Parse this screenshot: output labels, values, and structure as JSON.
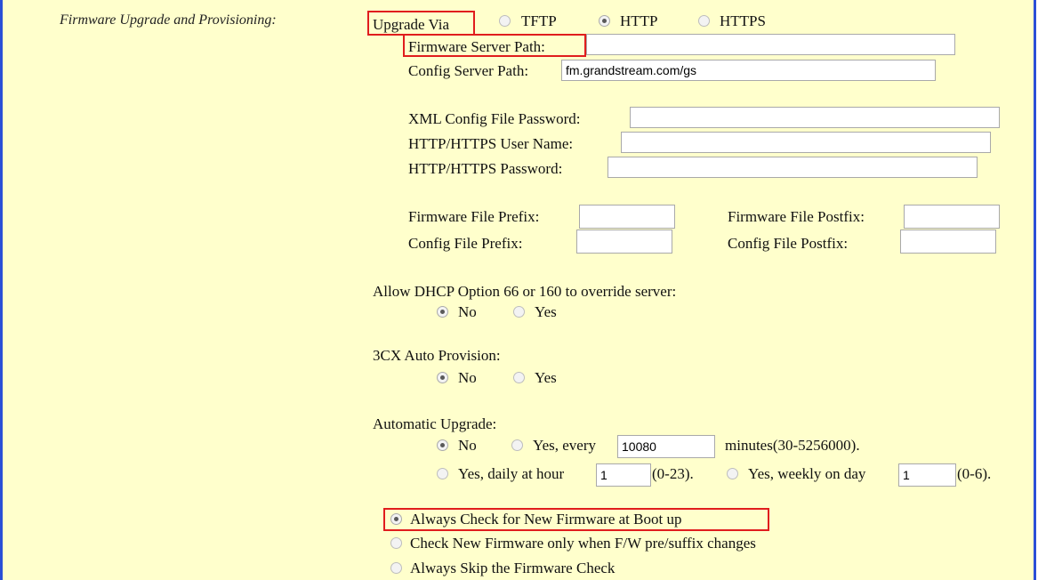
{
  "section": {
    "label": "Firmware Upgrade and Provisioning:"
  },
  "upgrade_via": {
    "label": "Upgrade Via",
    "options": [
      "TFTP",
      "HTTP",
      "HTTPS"
    ],
    "selected": "HTTP"
  },
  "firmware_server_path": {
    "label": "Firmware Server Path:",
    "value": ""
  },
  "config_server_path": {
    "label": "Config Server Path:",
    "value": "fm.grandstream.com/gs"
  },
  "xml_config_password": {
    "label": "XML Config File Password:",
    "value": ""
  },
  "http_user": {
    "label": "HTTP/HTTPS User Name:",
    "value": ""
  },
  "http_password": {
    "label": "HTTP/HTTPS Password:",
    "value": ""
  },
  "firmware_prefix": {
    "label": "Firmware File Prefix:",
    "value": ""
  },
  "firmware_postfix": {
    "label": "Firmware File Postfix:",
    "value": ""
  },
  "config_prefix": {
    "label": "Config File Prefix:",
    "value": ""
  },
  "config_postfix": {
    "label": "Config File Postfix:",
    "value": ""
  },
  "dhcp_override": {
    "label": "Allow DHCP Option 66 or 160 to override server:",
    "options": [
      "No",
      "Yes"
    ],
    "selected": "No"
  },
  "auto_provision": {
    "label": "3CX Auto Provision:",
    "options": [
      "No",
      "Yes"
    ],
    "selected": "No"
  },
  "automatic_upgrade": {
    "label": "Automatic Upgrade:",
    "no_label": "No",
    "every_label": "Yes, every",
    "every_value": "10080",
    "minutes_label": "minutes(30-5256000).",
    "daily_label": "Yes, daily at hour",
    "daily_value": "1",
    "daily_range": "(0-23).",
    "weekly_label": "Yes, weekly on day",
    "weekly_value": "1",
    "weekly_range": "(0-6).",
    "selected": "No"
  },
  "firmware_check": {
    "options": [
      "Always Check for New Firmware at Boot up",
      "Check New Firmware only when F/W pre/suffix changes",
      "Always Skip the Firmware Check"
    ],
    "selected": "Always Check for New Firmware at Boot up"
  }
}
